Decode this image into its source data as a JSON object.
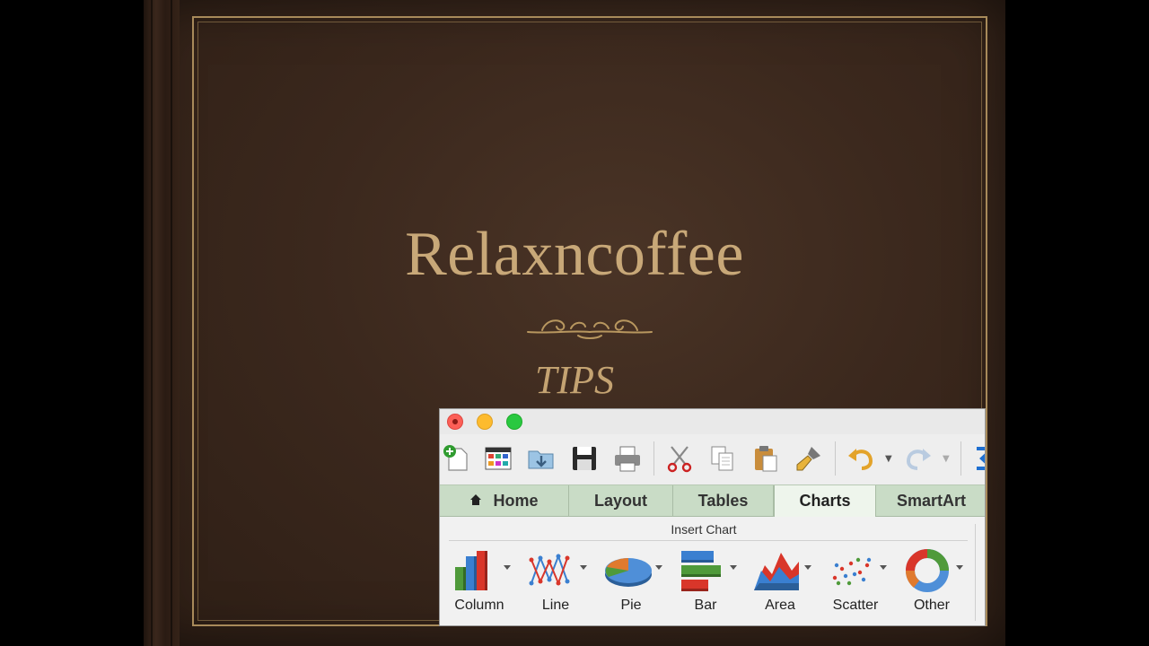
{
  "cover": {
    "title": "Relaxncoffee",
    "subtitle": "TIPS"
  },
  "window": {
    "controls": [
      "close",
      "minimize",
      "zoom"
    ]
  },
  "toolbar": {
    "icons": [
      "new-workbook-icon",
      "gallery-icon",
      "open-icon",
      "save-icon",
      "print-icon",
      "cut-icon",
      "copy-icon",
      "paste-icon",
      "format-painter-icon",
      "undo-icon",
      "redo-icon",
      "autosum-icon"
    ]
  },
  "tabs": [
    {
      "label": "Home"
    },
    {
      "label": "Layout"
    },
    {
      "label": "Tables"
    },
    {
      "label": "Charts",
      "active": true
    },
    {
      "label": "SmartArt"
    }
  ],
  "ribbon": {
    "group_label": "Insert Chart",
    "chart_types": [
      {
        "label": "Column",
        "icon": "column-chart-icon"
      },
      {
        "label": "Line",
        "icon": "line-chart-icon"
      },
      {
        "label": "Pie",
        "icon": "pie-chart-icon"
      },
      {
        "label": "Bar",
        "icon": "bar-chart-icon"
      },
      {
        "label": "Area",
        "icon": "area-chart-icon"
      },
      {
        "label": "Scatter",
        "icon": "scatter-chart-icon"
      },
      {
        "label": "Other",
        "icon": "other-chart-icon"
      }
    ]
  },
  "colors": {
    "cover_gold": "#c8a878",
    "tab_green": "#c9dcc6",
    "active_tab": "#eef5ec"
  }
}
